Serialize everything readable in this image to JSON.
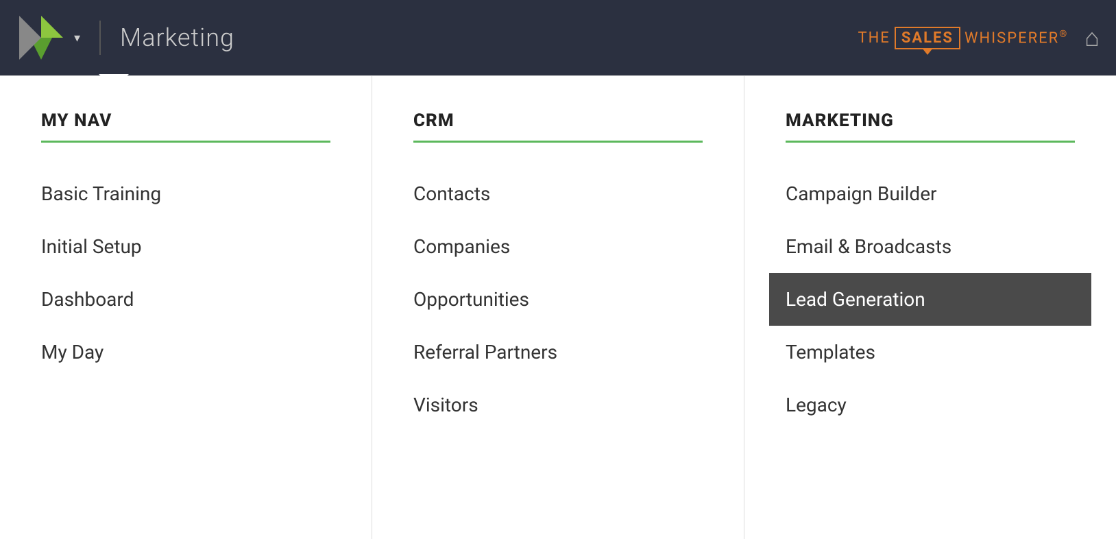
{
  "header": {
    "title": "Marketing",
    "dropdown_arrow": "▾",
    "brand": {
      "the": "THE",
      "sales": "SALES",
      "whisperer": "WHISPERER",
      "reg": "®"
    },
    "home_icon": "⌂"
  },
  "columns": [
    {
      "id": "my-nav",
      "heading": "MY NAV",
      "items": [
        {
          "label": "Basic Training",
          "active": false
        },
        {
          "label": "Initial Setup",
          "active": false
        },
        {
          "label": "Dashboard",
          "active": false
        },
        {
          "label": "My Day",
          "active": false
        }
      ]
    },
    {
      "id": "crm",
      "heading": "CRM",
      "items": [
        {
          "label": "Contacts",
          "active": false
        },
        {
          "label": "Companies",
          "active": false
        },
        {
          "label": "Opportunities",
          "active": false
        },
        {
          "label": "Referral Partners",
          "active": false
        },
        {
          "label": "Visitors",
          "active": false
        }
      ]
    },
    {
      "id": "marketing",
      "heading": "MARKETING",
      "items": [
        {
          "label": "Campaign Builder",
          "active": false
        },
        {
          "label": "Email & Broadcasts",
          "active": false
        },
        {
          "label": "Lead Generation",
          "active": true
        },
        {
          "label": "Templates",
          "active": false
        },
        {
          "label": "Legacy",
          "active": false
        }
      ]
    }
  ]
}
